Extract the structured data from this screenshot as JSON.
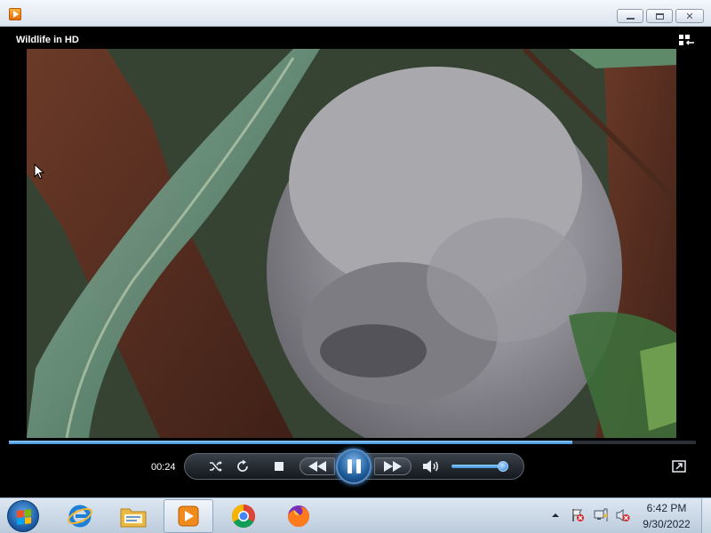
{
  "window": {
    "controls": {
      "minimize": "minimize",
      "maximize": "maximize",
      "close": "✕"
    }
  },
  "player": {
    "media_title": "Wildlife in HD",
    "elapsed_time": "00:24",
    "seek_progress": 0.82,
    "volume_level": 0.85,
    "state": "playing"
  },
  "icons": {
    "app": "media-player-icon",
    "switch_view": "switch-to-library-icon",
    "shuffle": "shuffle-icon",
    "repeat": "repeat-icon",
    "stop": "stop-icon",
    "previous": "previous-icon",
    "play_pause": "pause-icon",
    "next": "next-icon",
    "mute": "speaker-icon",
    "fullscreen": "fullscreen-icon"
  },
  "taskbar": {
    "pinned": [
      "internet-explorer",
      "windows-explorer",
      "windows-media-player",
      "google-chrome",
      "firefox"
    ],
    "active": "windows-media-player",
    "clock": {
      "time": "6:42 PM",
      "date": "9/30/2022"
    }
  },
  "colors": {
    "accent": "#3d8fd9",
    "titlebar": "#dbe4ef",
    "player_bg": "#000000"
  }
}
